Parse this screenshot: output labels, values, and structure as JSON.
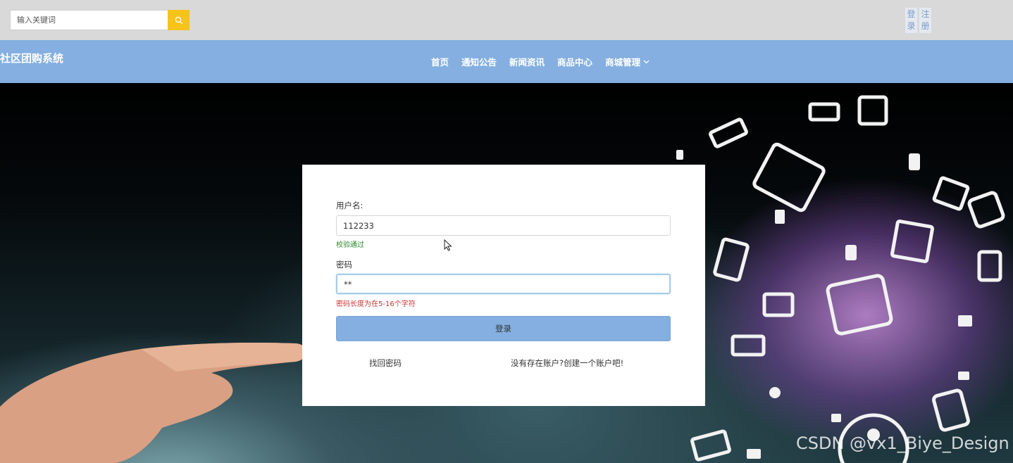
{
  "search": {
    "placeholder": "输入关键词"
  },
  "auth": {
    "login": "登录",
    "register": "注册"
  },
  "brand": "社区团购系统",
  "nav": [
    {
      "label": "首页"
    },
    {
      "label": "通知公告"
    },
    {
      "label": "新闻资讯"
    },
    {
      "label": "商品中心"
    },
    {
      "label": "商城管理"
    }
  ],
  "login_form": {
    "username_label": "用户名:",
    "username_value": "112233",
    "username_msg": "校验通过",
    "password_label": "密码",
    "password_value": "**",
    "password_msg": "密码长度为在5-16个字符",
    "submit_label": "登录",
    "forgot_link": "找回密码",
    "register_link": "没有存在账户?创建一个账户吧!"
  },
  "colors": {
    "nav_bg": "#84afe0",
    "topbar_bg": "#d9d9d9",
    "search_btn": "#f5c31a",
    "ok": "#2e8b2e",
    "error": "#cc3333"
  },
  "watermark": "CSDN @vx1_Biye_Design"
}
